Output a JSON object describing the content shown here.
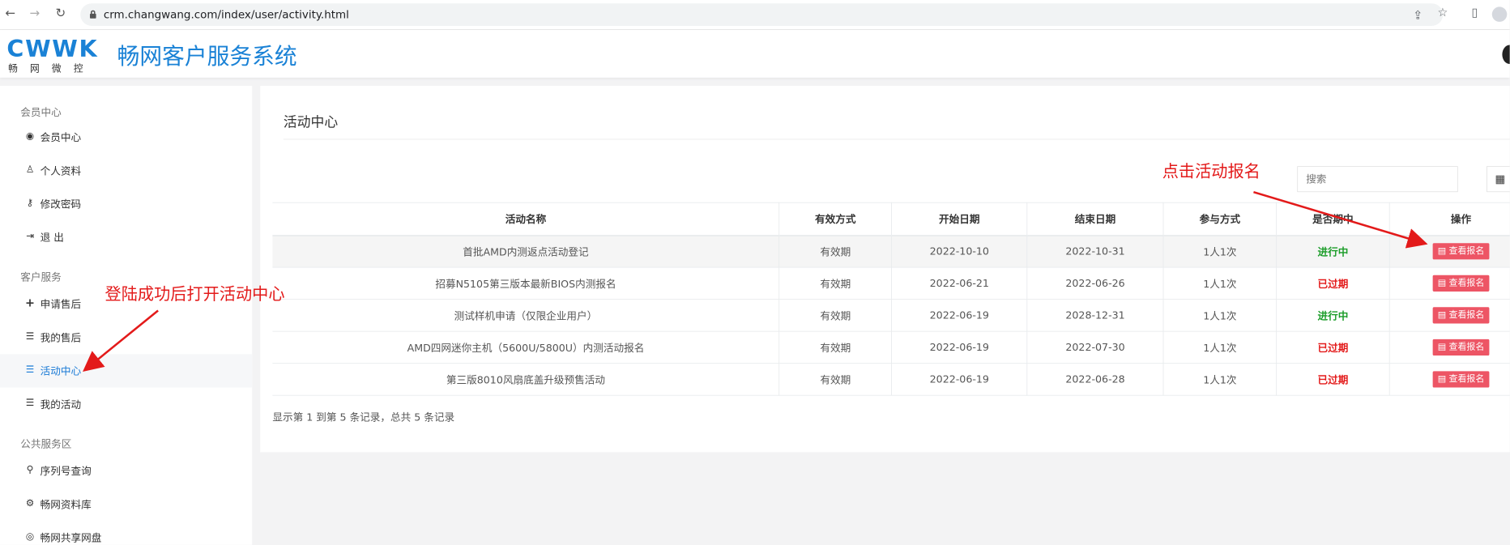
{
  "browser": {
    "url": "crm.changwang.com/index/user/activity.html"
  },
  "header": {
    "logo_text": "CWWK",
    "logo_sub": "畅网微控",
    "title": "畅网客户服务系统"
  },
  "sidebar": {
    "sections": [
      "会员中心",
      "客户服务",
      "公共服务区"
    ],
    "items": [
      {
        "label": "会员中心",
        "icon": "user-circle-icon"
      },
      {
        "label": "个人资料",
        "icon": "user-icon"
      },
      {
        "label": "修改密码",
        "icon": "key-icon"
      },
      {
        "label": "退 出",
        "icon": "logout-icon"
      },
      {
        "label": "申请售后",
        "icon": "plus-icon"
      },
      {
        "label": "我的售后",
        "icon": "server-icon"
      },
      {
        "label": "活动中心",
        "icon": "server-icon"
      },
      {
        "label": "我的活动",
        "icon": "server-icon"
      },
      {
        "label": "序列号查询",
        "icon": "search-icon"
      },
      {
        "label": "畅网资料库",
        "icon": "gear-icon"
      },
      {
        "label": "畅网共享网盘",
        "icon": "globe-icon"
      }
    ]
  },
  "main": {
    "title": "活动中心",
    "search_placeholder": "搜索",
    "columns": [
      "活动名称",
      "有效方式",
      "开始日期",
      "结束日期",
      "参与方式",
      "是否期中",
      "操作"
    ],
    "rows": [
      {
        "name": "首批AMD内测返点活动登记",
        "mode": "有效期",
        "start": "2022-10-10",
        "end": "2022-10-31",
        "join": "1人1次",
        "status": "进行中",
        "status_color": "#1a9c28",
        "action": "查看报名"
      },
      {
        "name": "招募N5105第三版本最新BIOS内测报名",
        "mode": "有效期",
        "start": "2022-06-21",
        "end": "2022-06-26",
        "join": "1人1次",
        "status": "已过期",
        "status_color": "#e31a1a",
        "action": "查看报名"
      },
      {
        "name": "测试样机申请（仅限企业用户）",
        "mode": "有效期",
        "start": "2022-06-19",
        "end": "2028-12-31",
        "join": "1人1次",
        "status": "进行中",
        "status_color": "#1a9c28",
        "action": "查看报名"
      },
      {
        "name": "AMD四网迷你主机（5600U/5800U）内测活动报名",
        "mode": "有效期",
        "start": "2022-06-19",
        "end": "2022-07-30",
        "join": "1人1次",
        "status": "已过期",
        "status_color": "#e31a1a",
        "action": "查看报名"
      },
      {
        "name": "第三版8010风扇底盖升级预售活动",
        "mode": "有效期",
        "start": "2022-06-19",
        "end": "2022-06-28",
        "join": "1人1次",
        "status": "已过期",
        "status_color": "#e31a1a",
        "action": "查看报名"
      }
    ],
    "footer": "显示第 1 到第 5 条记录，总共 5 条记录"
  },
  "annotations": {
    "left": "登陆成功后打开活动中心",
    "right": "点击活动报名",
    "color": "#e31a1a"
  }
}
